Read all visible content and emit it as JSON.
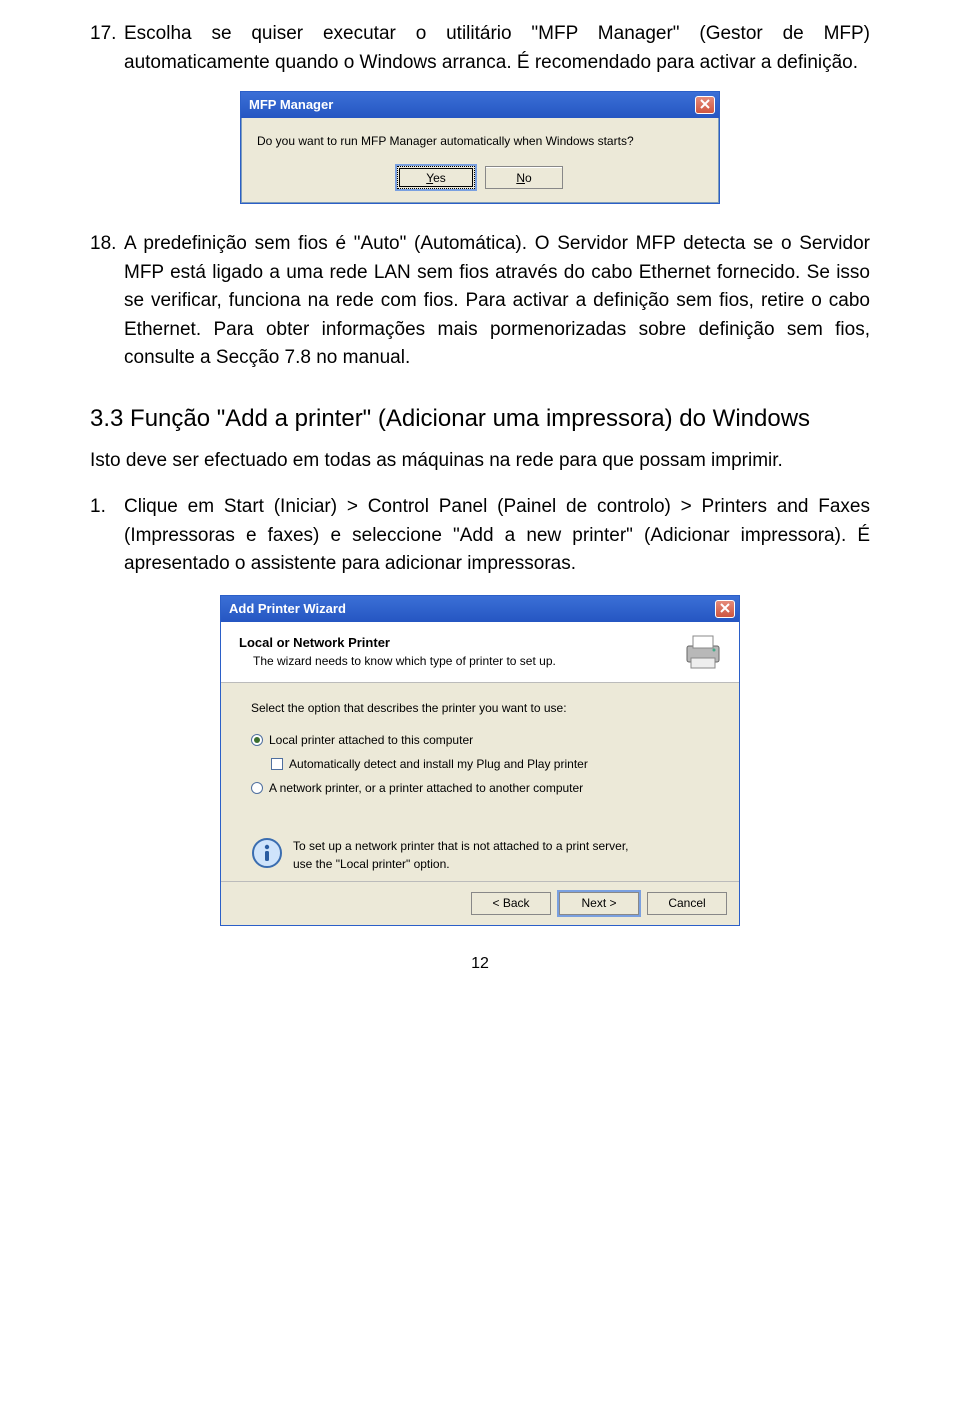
{
  "items": {
    "i17_num": "17.",
    "i17_text": "Escolha se quiser executar o utilitário \"MFP Manager\" (Gestor de MFP) automaticamente quando o Windows arranca. É recomendado para activar a definição.",
    "i18_num": "18.",
    "i18_text": "A predefinição sem fios é \"Auto\" (Automática). O Servidor MFP detecta se o Servidor MFP está ligado a uma rede LAN sem fios através do cabo Ethernet fornecido. Se isso se verificar, funciona na rede com fios. Para activar a definição sem fios, retire o cabo Ethernet. Para obter informações mais pormenorizadas sobre definição sem fios, consulte a Secção 7.8 no manual."
  },
  "dlg": {
    "title": "MFP Manager",
    "msg": "Do you want to run MFP Manager automatically when Windows starts?",
    "yes_u": "Y",
    "yes_rest": "es",
    "no_u": "N",
    "no_rest": "o"
  },
  "section": {
    "heading": "3.3 Função \"Add a printer\" (Adicionar uma impressora) do Windows",
    "intro": "Isto deve ser efectuado em todas as máquinas na rede para que possam imprimir.",
    "s1_num": "1.",
    "s1_text": "Clique em Start (Iniciar) > Control Panel (Painel de controlo) > Printers and Faxes (Impressoras e faxes) e seleccione \"Add a new printer\" (Adicionar impressora).   É apresentado o assistente para adicionar impressoras."
  },
  "wiz": {
    "title": "Add Printer Wizard",
    "head1": "Local or Network Printer",
    "head2": "The wizard needs to know which type of printer to set up.",
    "lead": "Select the option that describes the printer you want to use:",
    "opt1": "Local printer attached to this computer",
    "chk": "Automatically detect and install my Plug and Play printer",
    "opt2": "A network printer, or a printer attached to another computer",
    "info1": "To set up a network printer that is not attached to a print server,",
    "info2": "use the \"Local printer\" option.",
    "back": "< Back",
    "next": "Next >",
    "cancel": "Cancel"
  },
  "pagenum": "12"
}
